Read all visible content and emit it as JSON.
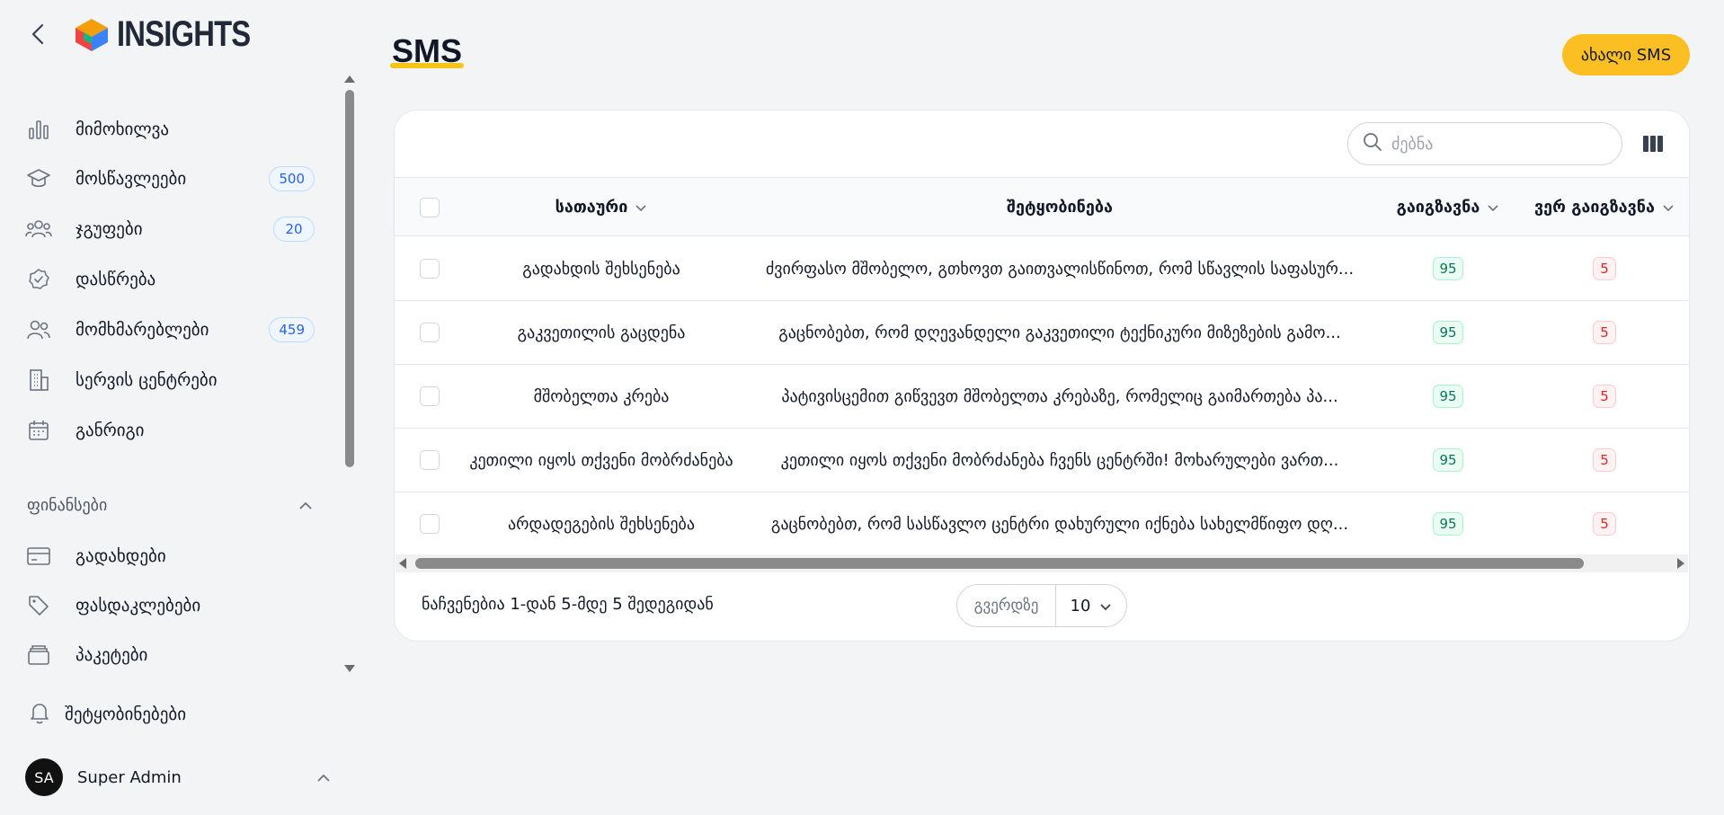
{
  "app": {
    "logo_text": "INSIGHTS"
  },
  "sidebar": {
    "items": [
      {
        "label": "მიმოხილვა",
        "icon": "bar-chart-icon"
      },
      {
        "label": "მოსწავლეები",
        "icon": "graduation-cap-icon",
        "badge": "500"
      },
      {
        "label": "ჯგუფები",
        "icon": "users-group-icon",
        "badge": "20"
      },
      {
        "label": "დასწრება",
        "icon": "check-badge-icon"
      },
      {
        "label": "მომხმარებლები",
        "icon": "users-icon",
        "badge": "459"
      },
      {
        "label": "სერვის ცენტრები",
        "icon": "building-icon"
      },
      {
        "label": "განრიგი",
        "icon": "calendar-icon"
      }
    ],
    "section_title": "ფინანსები",
    "finance_items": [
      {
        "label": "გადახდები",
        "icon": "credit-card-icon"
      },
      {
        "label": "ფასდაკლებები",
        "icon": "tag-icon"
      },
      {
        "label": "პაკეტები",
        "icon": "wallet-icon"
      }
    ],
    "notifications_label": "შეტყობინებები",
    "user": {
      "initials": "SA",
      "name": "Super Admin"
    }
  },
  "main": {
    "title": "SMS",
    "new_button": "ახალი SMS",
    "search_placeholder": "ძებნა",
    "columns": {
      "title": "სათაური",
      "message": "შეტყობინება",
      "sent": "გაიგზავნა",
      "not_sent": "ვერ გაიგზავნა"
    },
    "rows": [
      {
        "title": "გადახდის შეხსენება",
        "message": "ძვირფასო მშობელო, გთხოვთ გაითვალისწინოთ, რომ სწავლის საფასურ...",
        "sent": "95",
        "not_sent": "5"
      },
      {
        "title": "გაკვეთილის გაცდენა",
        "message": "გაცნობებთ, რომ დღევანდელი გაკვეთილი ტექნიკური მიზეზების გამო...",
        "sent": "95",
        "not_sent": "5"
      },
      {
        "title": "მშობელთა კრება",
        "message": "პატივისცემით გიწვევთ მშობელთა კრებაზე, რომელიც გაიმართება პა...",
        "sent": "95",
        "not_sent": "5"
      },
      {
        "title": "კეთილი იყოს თქვენი მობრძანება",
        "message": "კეთილი იყოს თქვენი მობრძანება ჩვენს ცენტრში! მოხარულები ვართ...",
        "sent": "95",
        "not_sent": "5"
      },
      {
        "title": "არდადეგების შეხსენება",
        "message": "გაცნობებთ, რომ სასწავლო ცენტრი დახურული იქნება სახელმწიფო დღ...",
        "sent": "95",
        "not_sent": "5"
      }
    ],
    "footer_text": "ნაჩვენებია 1-დან 5-მდე 5 შედეგიდან",
    "pager_label": "გვერდზე",
    "pager_value": "10"
  },
  "colors": {
    "accent": "#fbbf24",
    "badge_blue": "#2563eb",
    "green": "#047857",
    "red": "#dc2626"
  }
}
